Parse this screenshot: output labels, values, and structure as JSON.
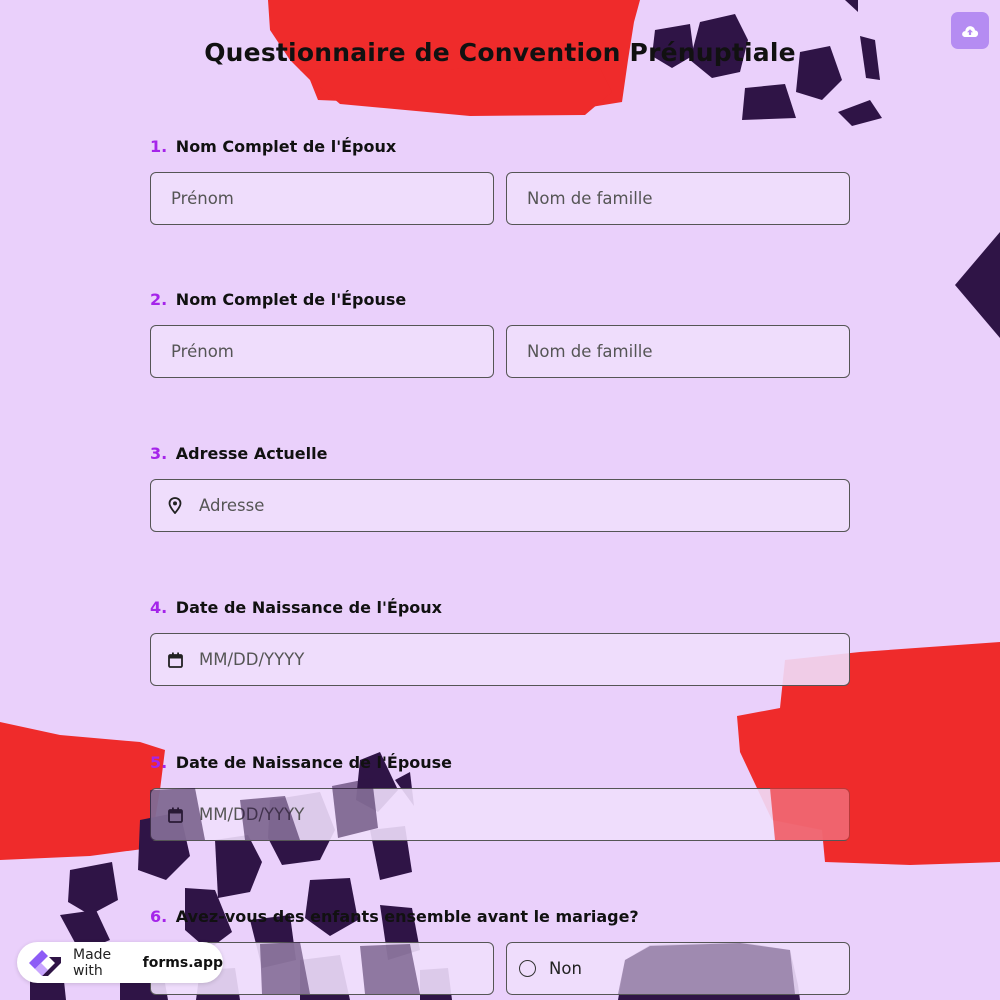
{
  "form": {
    "title": "Questionnaire de Convention Prénuptiale"
  },
  "questions": [
    {
      "number": "1.",
      "label": "Nom Complet de l'Époux",
      "first_placeholder": "Prénom",
      "last_placeholder": "Nom de famille"
    },
    {
      "number": "2.",
      "label": "Nom Complet de l'Épouse",
      "first_placeholder": "Prénom",
      "last_placeholder": "Nom de famille"
    },
    {
      "number": "3.",
      "label": "Adresse Actuelle",
      "placeholder": "Adresse"
    },
    {
      "number": "4.",
      "label": "Date de Naissance de l'Époux",
      "placeholder": "MM/DD/YYYY"
    },
    {
      "number": "5.",
      "label": "Date de Naissance de l'Épouse",
      "placeholder": "MM/DD/YYYY"
    },
    {
      "number": "6.",
      "label": "Avez-vous des enfants ensemble avant le mariage?",
      "option_no": "Non"
    }
  ],
  "badge": {
    "made_with": "Made with",
    "brand": "forms.app"
  },
  "colors": {
    "background": "#ead0fb",
    "accent_number": "#a524ea",
    "brush_red": "#ef2b2b",
    "brush_dark": "#2f1446",
    "upload_button": "#b58cf2"
  },
  "icons": {
    "upload": "cloud-upload-icon",
    "address": "location-pin-icon",
    "date": "calendar-icon",
    "logo": "forms-app-logo-icon"
  }
}
